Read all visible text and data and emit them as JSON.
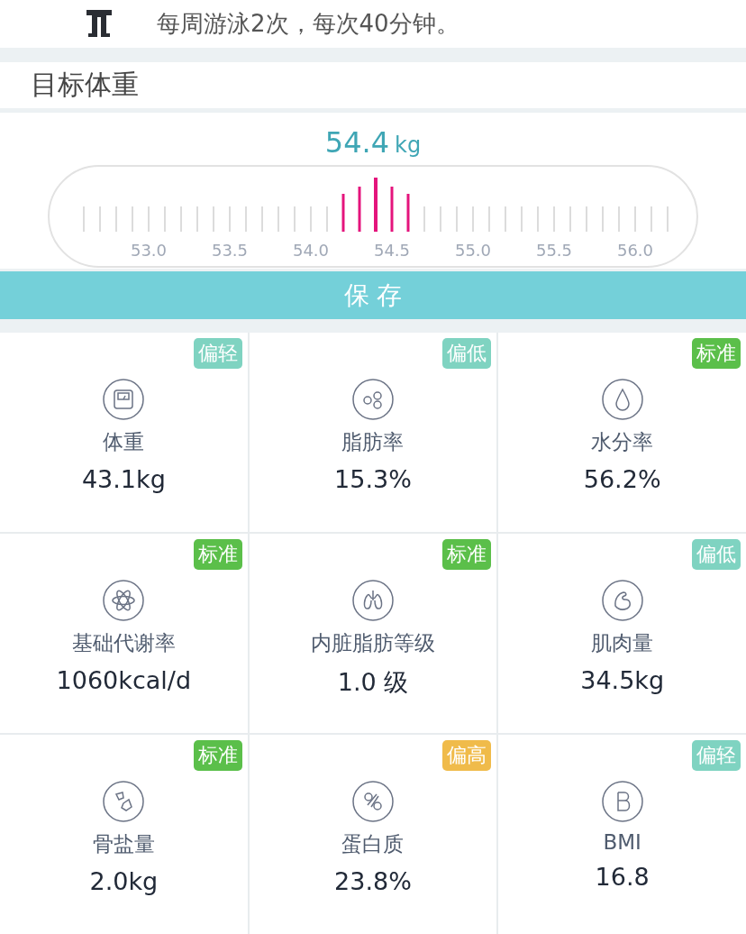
{
  "plan": {
    "text": "每周游泳2次，每次40分钟。"
  },
  "target": {
    "title": "目标体重",
    "value": "54.4",
    "unit": "kg",
    "labels": [
      "53.0",
      "53.5",
      "54.0",
      "54.5",
      "55.0",
      "55.5",
      "56.0"
    ]
  },
  "save_button": "保 存",
  "metrics": [
    {
      "name": "体重",
      "value": "43.1kg",
      "status": "偏轻",
      "color": "#7fd3c1"
    },
    {
      "name": "脂肪率",
      "value": "15.3%",
      "status": "偏低",
      "color": "#7fd3c1"
    },
    {
      "name": "水分率",
      "value": "56.2%",
      "status": "标准",
      "color": "#5bbf4a"
    },
    {
      "name": "基础代谢率",
      "value": "1060kcal/d",
      "status": "标准",
      "color": "#5bbf4a"
    },
    {
      "name": "内脏脂肪等级",
      "value": "1.0 级",
      "status": "标准",
      "color": "#5bbf4a"
    },
    {
      "name": "肌肉量",
      "value": "34.5kg",
      "status": "偏低",
      "color": "#7fd3c1"
    },
    {
      "name": "骨盐量",
      "value": "2.0kg",
      "status": "标准",
      "color": "#5bbf4a"
    },
    {
      "name": "蛋白质",
      "value": "23.8%",
      "status": "偏高",
      "color": "#f0bb4a"
    },
    {
      "name": "BMI",
      "value": "16.8",
      "status": "偏轻",
      "color": "#7fd3c1"
    }
  ]
}
